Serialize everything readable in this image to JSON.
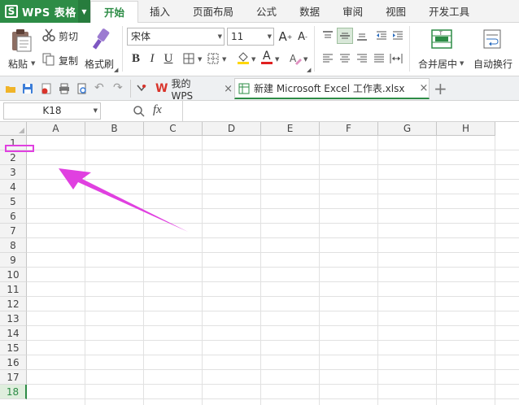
{
  "menubar": {
    "app_logo": "S",
    "app_title": "WPS 表格",
    "tabs": [
      {
        "label": "开始",
        "active": true
      },
      {
        "label": "插入"
      },
      {
        "label": "页面布局"
      },
      {
        "label": "公式"
      },
      {
        "label": "数据"
      },
      {
        "label": "审阅"
      },
      {
        "label": "视图"
      },
      {
        "label": "开发工具"
      }
    ]
  },
  "ribbon": {
    "paste_label": "粘贴",
    "cut_label": "剪切",
    "copy_label": "复制",
    "format_painter_label": "格式刷",
    "font_name": "宋体",
    "font_size": "11",
    "bold": "B",
    "italic": "I",
    "underline": "U",
    "font_color_letter": "A",
    "merge_center_label": "合并居中",
    "wrap_text_label": "自动换行"
  },
  "qbar": {
    "tab_mywps": "我的WPS",
    "tab_active": "新建 Microsoft Excel 工作表.xlsx",
    "close_glyph": "×",
    "new_tab_glyph": "+"
  },
  "formula_bar": {
    "name_box": "K18",
    "fx_label": "fx",
    "formula_value": ""
  },
  "grid": {
    "columns": [
      "A",
      "B",
      "C",
      "D",
      "E",
      "F",
      "G",
      "H"
    ],
    "rows": [
      "1",
      "2",
      "3",
      "4",
      "5",
      "6",
      "7",
      "8",
      "9",
      "10",
      "11",
      "12",
      "13",
      "14",
      "15",
      "16",
      "17",
      "18"
    ],
    "selected_row": "18"
  },
  "colors": {
    "accent": "#2d8c46",
    "annotation": "#e040e0",
    "font_color_bar": "#e02020",
    "fill_color_bar": "#ffd700"
  }
}
